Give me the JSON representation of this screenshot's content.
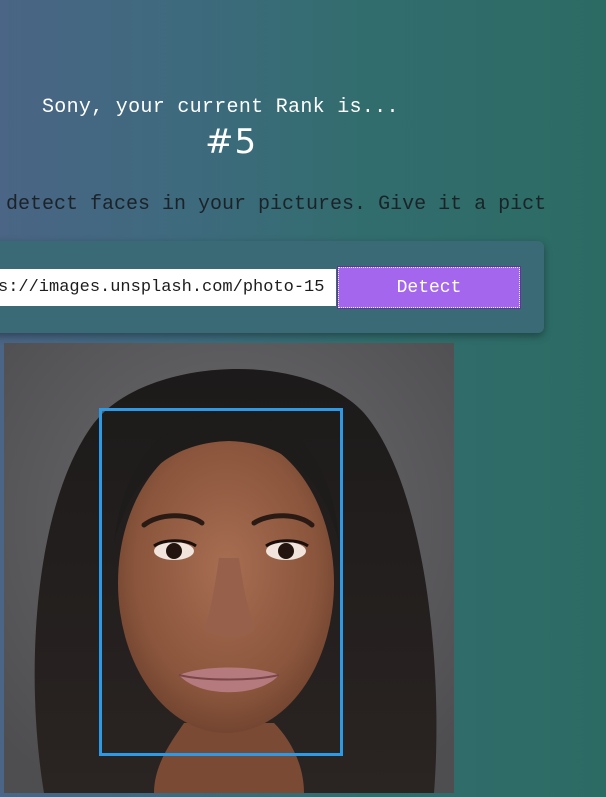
{
  "greeting": {
    "rank_text": "Sony, your current Rank is...",
    "rank_value": "#5"
  },
  "description": "l detect faces in your pictures. Give it a pict",
  "form": {
    "url_value": "s://images.unsplash.com/photo-15",
    "detect_label": "Detect"
  },
  "result": {
    "image_subject": "portrait of a woman with long dark hair",
    "faces_detected": 1,
    "box_color": "#2c9ae6"
  },
  "colors": {
    "button": "#a566ee",
    "box": "#2c9ae6",
    "panel": "#3a6a75"
  }
}
